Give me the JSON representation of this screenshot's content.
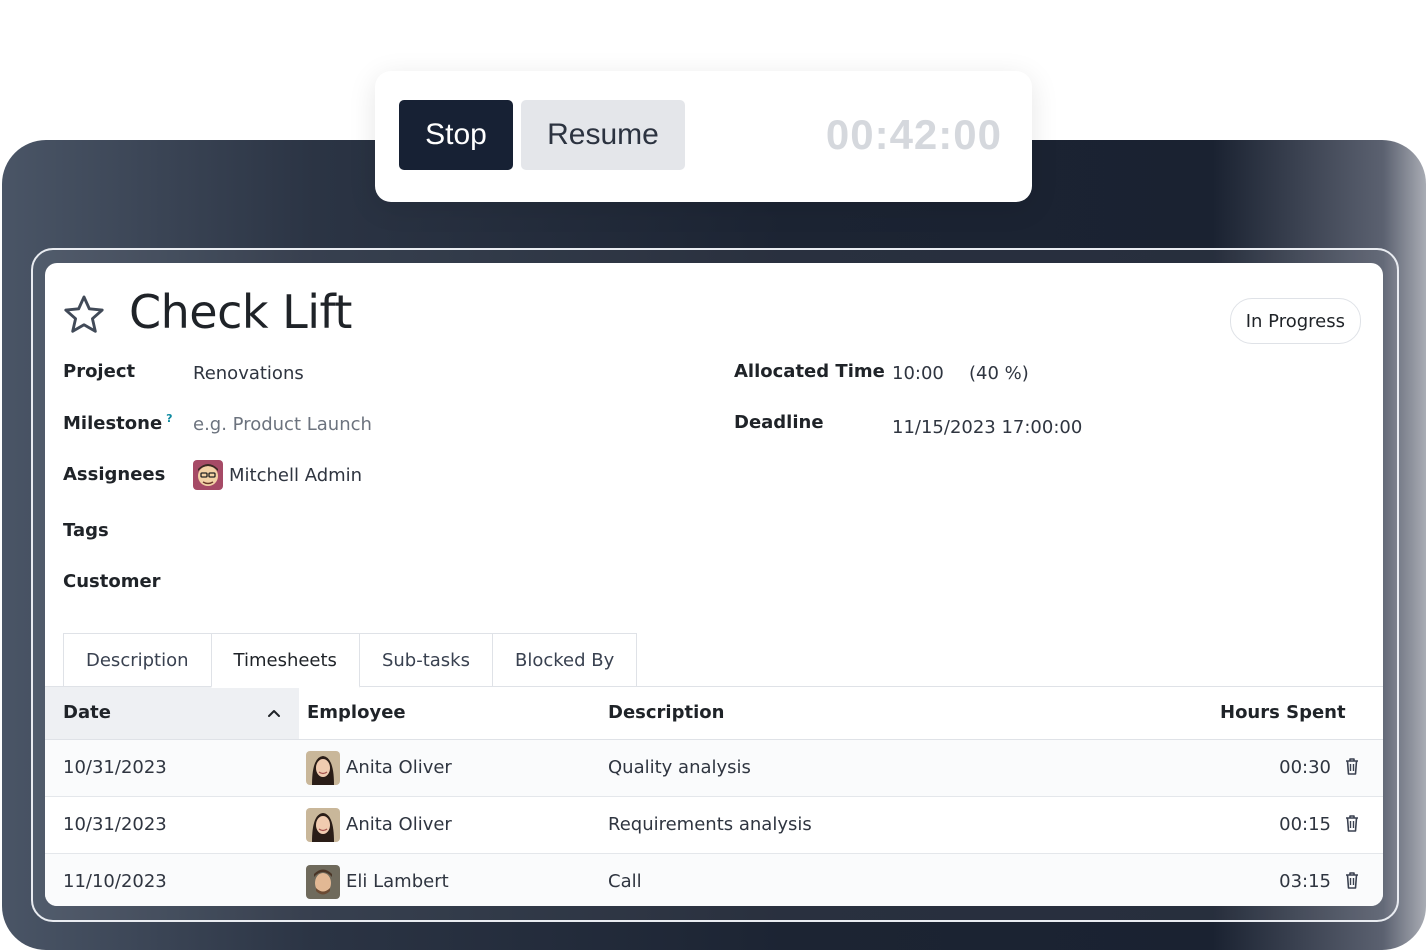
{
  "timer": {
    "stop_label": "Stop",
    "resume_label": "Resume",
    "elapsed": "00:42:00"
  },
  "task": {
    "title": "Check Lift",
    "status": "In Progress",
    "fields": {
      "project_label": "Project",
      "project_value": "Renovations",
      "milestone_label": "Milestone",
      "milestone_help": "?",
      "milestone_placeholder": "e.g. Product Launch",
      "assignees_label": "Assignees",
      "assignee_name": "Mitchell Admin",
      "tags_label": "Tags",
      "customer_label": "Customer",
      "allocated_label": "Allocated Time",
      "allocated_value": "10:00",
      "allocated_percent": "(40 %)",
      "deadline_label": "Deadline",
      "deadline_value": "11/15/2023 17:00:00"
    }
  },
  "tabs": [
    {
      "label": "Description"
    },
    {
      "label": "Timesheets",
      "active": true
    },
    {
      "label": "Sub-tasks"
    },
    {
      "label": "Blocked By"
    }
  ],
  "timesheets": {
    "columns": {
      "date": "Date",
      "employee": "Employee",
      "description": "Description",
      "hours": "Hours Spent"
    },
    "rows": [
      {
        "date": "10/31/2023",
        "employee": "Anita Oliver",
        "description": "Quality analysis",
        "hours": "00:30"
      },
      {
        "date": "10/31/2023",
        "employee": "Anita Oliver",
        "description": "Requirements analysis",
        "hours": "00:15"
      },
      {
        "date": "11/10/2023",
        "employee": "Eli Lambert",
        "description": "Call",
        "hours": "03:15"
      }
    ]
  },
  "colors": {
    "stop_button": "#172134",
    "backdrop": "#1c2433",
    "help_accent": "#0e8aa0"
  },
  "icons": {
    "favorite": "star-outline-icon",
    "sort": "chevron-up-icon",
    "delete": "trash-icon"
  }
}
